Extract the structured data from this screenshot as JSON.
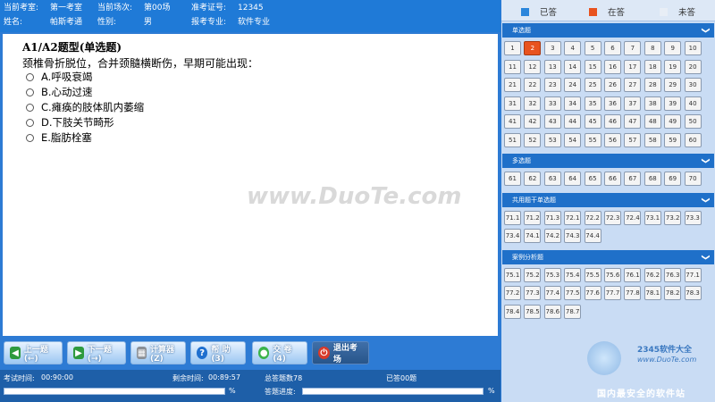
{
  "header": {
    "room_label": "当前考室:",
    "room_value": "第一考室",
    "session_label": "当前场次:",
    "session_value": "第00场",
    "id_label": "准考证号:",
    "id_value": "12345",
    "name_label": "姓名:",
    "name_value": "帕斯考通",
    "gender_label": "性别:",
    "gender_value": "男",
    "major_label": "报考专业:",
    "major_value": "软件专业"
  },
  "question": {
    "type_title": "A1/A2题型(单选题)",
    "stem": "颈椎骨折脱位，合并颈髓横断伤，早期可能出现：",
    "options": [
      "A.呼吸衰竭",
      "B.心动过速",
      "C.瘫痪的肢体肌内萎缩",
      "D.下肢关节畸形",
      "E.脂肪栓塞"
    ]
  },
  "toolbar": {
    "prev": "上一题(←)",
    "next": "下一题(→)",
    "calc": "计算器(Z)",
    "help": "帮  助(3)",
    "submit": "交  卷(4)",
    "exit": "退出考场"
  },
  "status": {
    "exam_time_label": "考试时间:",
    "exam_time_value": "00:90:00",
    "remaining_label": "剩余时间:",
    "remaining_value": "00:89:57",
    "total_label": "总答题数78",
    "answered_label": "已答00题",
    "progress_label": "答题进度:",
    "percent": "%",
    "time_progress": 0.0,
    "answer_progress": 0.0
  },
  "legend": {
    "answered": "已答",
    "current": "在答",
    "unanswered": "未答",
    "answered_color": "#2b86dc",
    "current_color": "#e8531f",
    "unanswered_color": "#e8eef6"
  },
  "sections": [
    {
      "title": "单选题",
      "items": [
        "1",
        "2",
        "3",
        "4",
        "5",
        "6",
        "7",
        "8",
        "9",
        "10",
        "11",
        "12",
        "13",
        "14",
        "15",
        "16",
        "17",
        "18",
        "19",
        "20",
        "21",
        "22",
        "23",
        "24",
        "25",
        "26",
        "27",
        "28",
        "29",
        "30",
        "31",
        "32",
        "33",
        "34",
        "35",
        "36",
        "37",
        "38",
        "39",
        "40",
        "41",
        "42",
        "43",
        "44",
        "45",
        "46",
        "47",
        "48",
        "49",
        "50",
        "51",
        "52",
        "53",
        "54",
        "55",
        "56",
        "57",
        "58",
        "59",
        "60"
      ]
    },
    {
      "title": "多选题",
      "items": [
        "61",
        "62",
        "63",
        "64",
        "65",
        "66",
        "67",
        "68",
        "69",
        "70"
      ]
    },
    {
      "title": "共用题干单选题",
      "items": [
        "71.1",
        "71.2",
        "71.3",
        "72.1",
        "72.2",
        "72.3",
        "72.4",
        "73.1",
        "73.2",
        "73.3",
        "73.4",
        "74.1",
        "74.2",
        "74.3",
        "74.4"
      ]
    },
    {
      "title": "案例分析题",
      "items": [
        "75.1",
        "75.2",
        "75.3",
        "75.4",
        "75.5",
        "75.6",
        "76.1",
        "76.2",
        "76.3",
        "77.1",
        "77.2",
        "77.3",
        "77.4",
        "77.5",
        "77.6",
        "77.7",
        "77.8",
        "78.1",
        "78.2",
        "78.3",
        "78.4",
        "78.5",
        "78.6",
        "78.7"
      ]
    }
  ],
  "current_question": "2",
  "watermark": {
    "main": "www.DuoTe.com",
    "brand": "2345软件大全",
    "site": "www.DuoTe.com",
    "slogan": "国内最安全的软件站"
  }
}
